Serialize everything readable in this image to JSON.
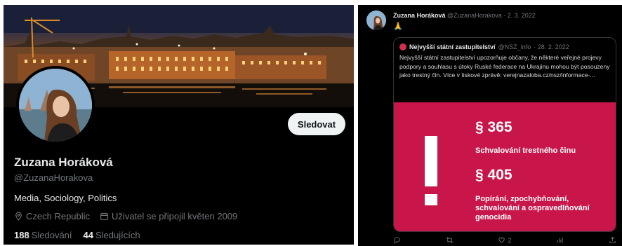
{
  "profile": {
    "name": "Zuzana Horáková",
    "handle": "@ZuzanaHorakova",
    "bio": "Media, Sociology, Politics",
    "location": "Czech Republic",
    "joined": "Uživatel se připojil květen 2009",
    "follow_label": "Sledovat",
    "following_count": "188",
    "following_label": "Sledování",
    "followers_count": "44",
    "followers_label": "Sledujících",
    "icons": {
      "location": "location-pin-icon",
      "joined": "calendar-icon"
    },
    "colors": {
      "background": "#000000",
      "button": "#eff3f4"
    }
  },
  "tweet": {
    "author_name": "Zuzana Horáková",
    "author_handle": "@ZuzanaHorakova",
    "date": "· 2. 3. 2022",
    "emoji": "🙏",
    "quote": {
      "author_name": "Nejvyšší státní zastupitelství",
      "author_handle": "@NSZ_info",
      "date": "· 28. 2. 2022",
      "text": "Nejvyšší státní zastupitelství upozorňuje občany, že některé veřejné projevy podpory a souhlasu s útoky Ruské federace na Ukrajinu mohou být posouzeny jako trestný čin. Více v tiskové zprávě: verejnazaloba.cz/nsz/informace-...",
      "card": {
        "section1": "§ 365",
        "section1_text": "Schvalování trestného činu",
        "section2": "§ 405",
        "section2_text": "Popírání, zpochybňování, schvalování a ospravedlňování genocidia",
        "color": "#c8164a"
      }
    },
    "actions": {
      "reply_icon": "reply-icon",
      "retweet_icon": "retweet-icon",
      "like_icon": "heart-icon",
      "like_count": "2",
      "views_icon": "views-icon",
      "share_icon": "share-icon"
    }
  }
}
